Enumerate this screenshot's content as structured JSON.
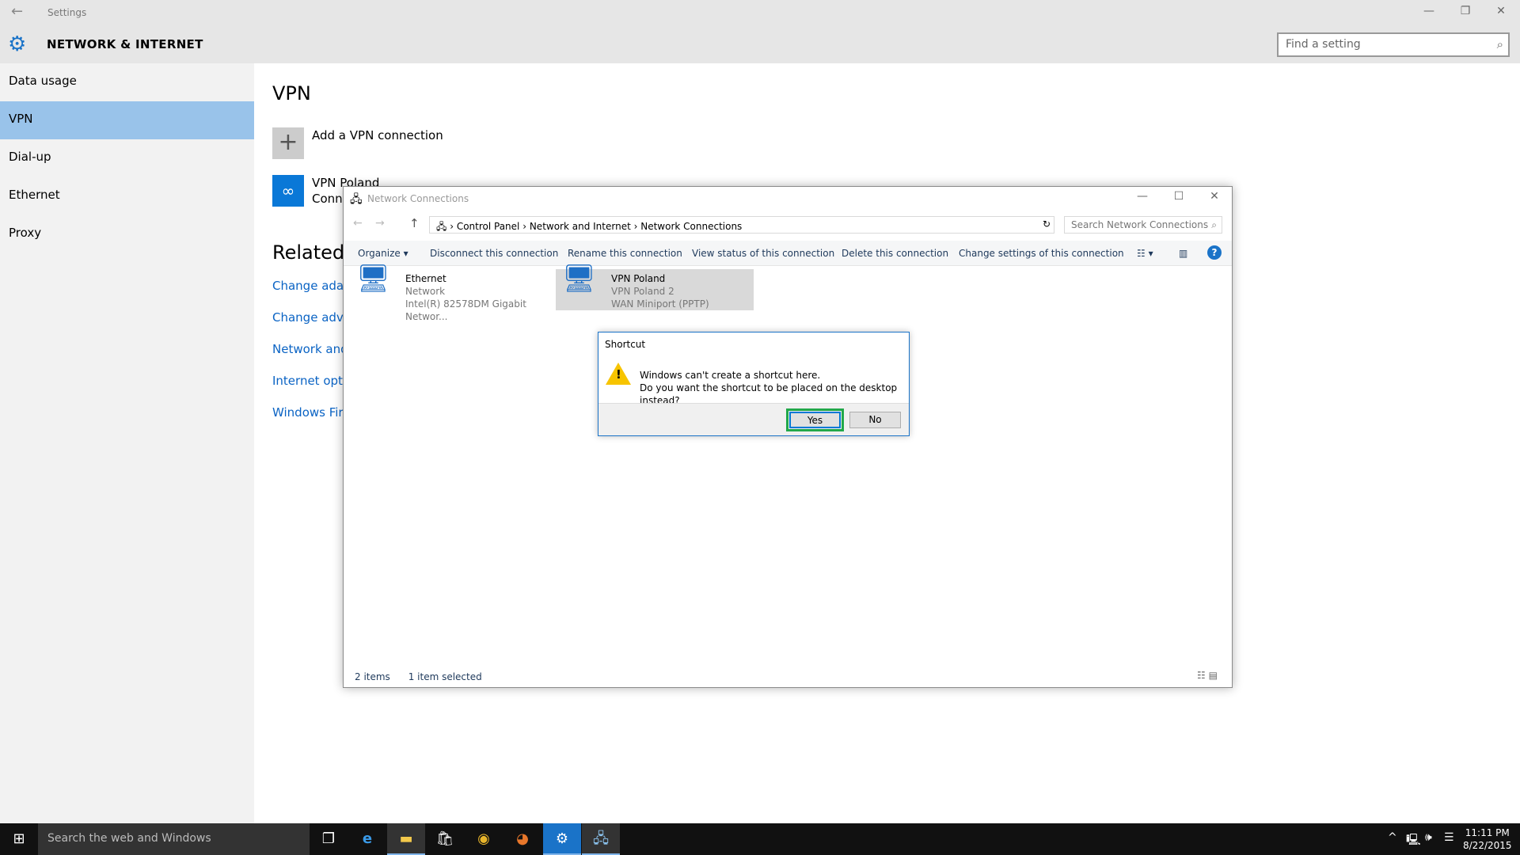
{
  "settings": {
    "title": "Settings",
    "section": "NETWORK & INTERNET",
    "search_placeholder": "Find a setting",
    "sidebar": [
      {
        "label": "Data usage"
      },
      {
        "label": "VPN",
        "selected": true
      },
      {
        "label": "Dial-up"
      },
      {
        "label": "Ethernet"
      },
      {
        "label": "Proxy"
      }
    ],
    "heading": "VPN",
    "add_vpn": "Add a VPN connection",
    "vpn_name": "VPN Poland",
    "vpn_status": "Conne",
    "related": "Related s",
    "links": [
      "Change adapt",
      "Change advar",
      "Network and",
      "Internet optio",
      "Windows Fire"
    ]
  },
  "netwin": {
    "title": "Network Connections",
    "breadcrumb": [
      "Control Panel",
      "Network and Internet",
      "Network Connections"
    ],
    "search_placeholder": "Search Network Connections",
    "commands": [
      "Organize ▾",
      "Disconnect this connection",
      "Rename this connection",
      "View status of this connection",
      "Delete this connection",
      "Change settings of this connection"
    ],
    "items": [
      {
        "name": "Ethernet",
        "line2": "Network",
        "line3": "Intel(R) 82578DM Gigabit Networ..."
      },
      {
        "name": "VPN Poland",
        "line2": "VPN Poland  2",
        "line3": "WAN Miniport (PPTP)",
        "selected": true
      }
    ],
    "status_count": "2 items",
    "status_selected": "1 item selected"
  },
  "dialog": {
    "title": "Shortcut",
    "line1": "Windows can't create a shortcut here.",
    "line2": "Do you want the shortcut to be placed on the desktop instead?",
    "yes": "Yes",
    "no": "No",
    "highlight_color": "#21a84a"
  },
  "taskbar": {
    "search_placeholder": "Search the web and Windows",
    "time": "11:11 PM",
    "date": "8/22/2015"
  },
  "colors": {
    "accent": "#0a78d7",
    "sidebar_selected": "#99c3ea",
    "link": "#0a63c4"
  }
}
